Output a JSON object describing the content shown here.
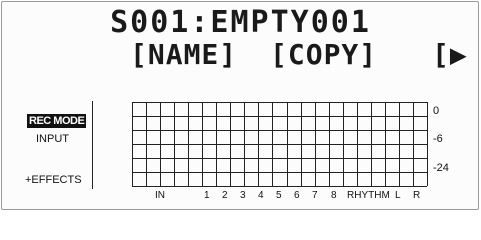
{
  "screen": {
    "title": "S001:EMPTY001",
    "functions": [
      "[NAME]",
      "[COPY]"
    ],
    "next_symbol": "[▶"
  },
  "menu": {
    "rec_mode": "REC MODE",
    "input": "INPUT",
    "effects": "+EFFECTS"
  },
  "meter": {
    "scale": [
      "0",
      "-6",
      "-24"
    ],
    "channels": [
      "IN",
      "1",
      "2",
      "3",
      "4",
      "5",
      "6",
      "7",
      "8",
      "RHYTHM",
      "L",
      "R"
    ]
  }
}
